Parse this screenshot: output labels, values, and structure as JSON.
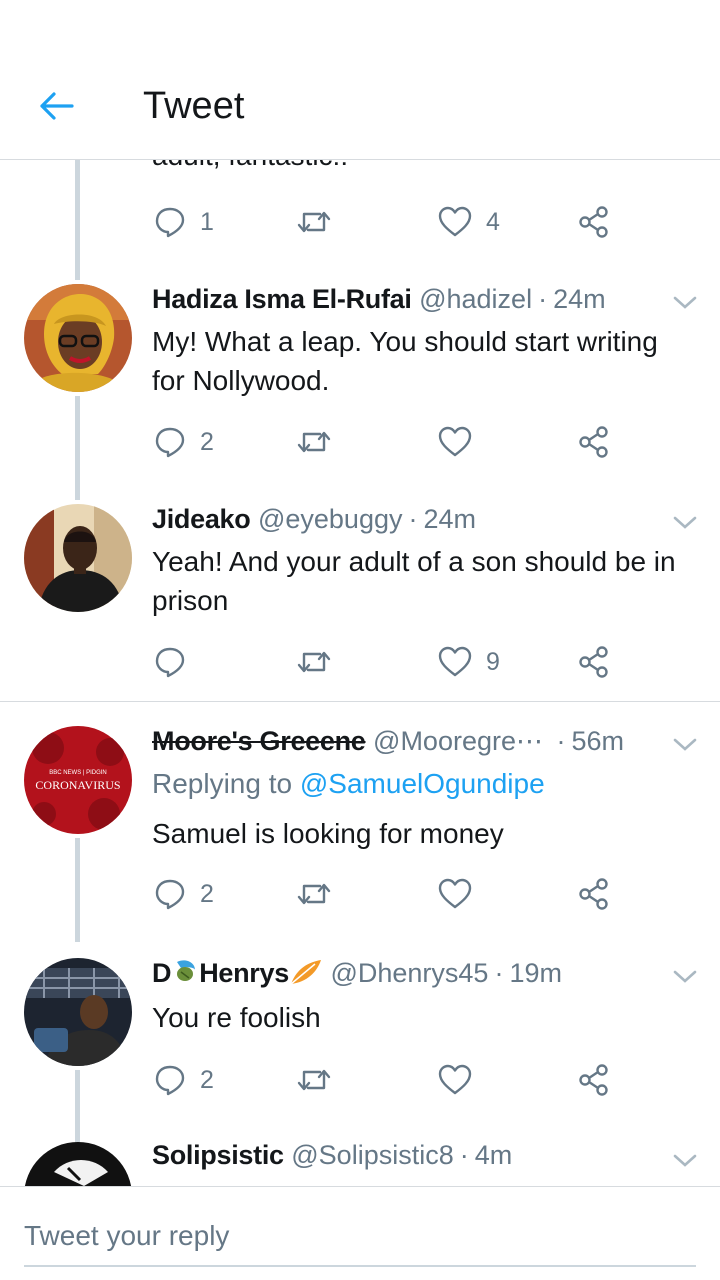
{
  "header": {
    "title": "Tweet",
    "back_icon": "back-arrow-icon",
    "accent": "#1da1f2"
  },
  "cut_text": "adult, fantastic!!",
  "top_actions": {
    "reply_count": "1",
    "like_count": "4"
  },
  "tweets": [
    {
      "name": "Hadiza Isma El-Rufai",
      "handle": "@hadizel",
      "time": "24m",
      "text": "My! What a leap. You should start writing for Nollywood.",
      "reply_count": "2",
      "retweet_count": "",
      "like_count": ""
    },
    {
      "name": "Jideako",
      "handle": "@eyebuggy",
      "time": "24m",
      "text": "Yeah! And your adult of a son should be in prison",
      "reply_count": "",
      "retweet_count": "",
      "like_count": "9"
    },
    {
      "name": "Moore's Greeene",
      "handle": "@Mooregre⋯",
      "time": "56m",
      "replying_prefix": "Replying to",
      "replying_to": "@SamuelOgundipe",
      "text": "Samuel is looking for money",
      "reply_count": "2",
      "retweet_count": "",
      "like_count": "",
      "avatar_text_top": "BBC NEWS | PIDGIN",
      "avatar_text": "CORONAVIRUS"
    },
    {
      "name": "D🍵Henrys🪽",
      "name_plain": "D",
      "name_rest": "Henrys",
      "handle": "@Dhenrys45",
      "time": "19m",
      "text": "You re foolish",
      "reply_count": "2",
      "retweet_count": "",
      "like_count": ""
    },
    {
      "name": "Solipsistic",
      "handle": "@Solipsistic8",
      "time": "4m"
    }
  ],
  "composer": {
    "placeholder": "Tweet your reply"
  }
}
